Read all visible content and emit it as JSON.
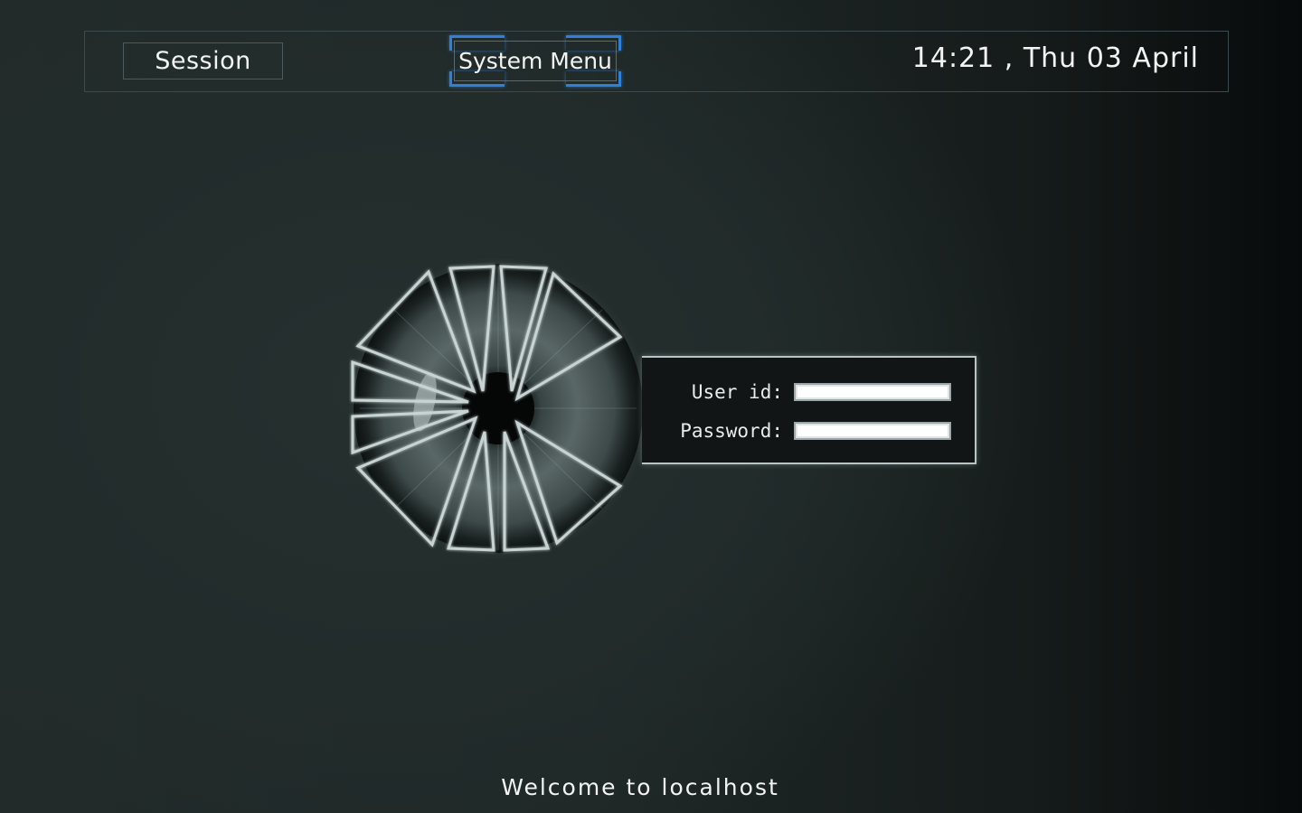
{
  "topbar": {
    "session_label": "Session",
    "system_menu_label": "System Menu",
    "clock_text": "14:21 , Thu 03 April"
  },
  "login": {
    "user_label": "User id:",
    "user_value": "",
    "password_label": "Password:",
    "password_value": ""
  },
  "footer": {
    "welcome_text": "Welcome to localhost"
  },
  "icons": {
    "logo": "iris-eye-logo"
  },
  "colors": {
    "accent": "#2f80d8",
    "background": "#1f2827",
    "panel": "#111515",
    "outline": "#b9c4c4"
  }
}
